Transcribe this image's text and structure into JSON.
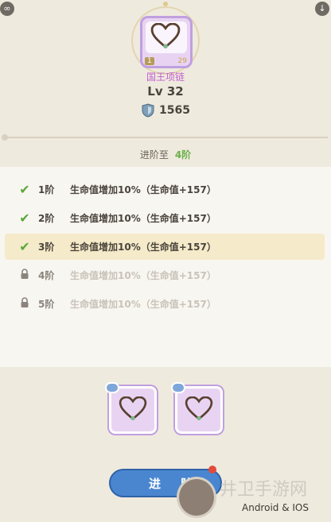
{
  "item": {
    "name": "国王项链",
    "level_tag": "1",
    "count_tag": "29",
    "level_text": "Lv 32",
    "power_value": "1565"
  },
  "advance": {
    "prefix": "进阶至",
    "target": "4阶"
  },
  "stages": [
    {
      "stage": "1阶",
      "desc": "生命值增加10%（生命值+157）",
      "status": "done"
    },
    {
      "stage": "2阶",
      "desc": "生命值增加10%（生命值+157）",
      "status": "done"
    },
    {
      "stage": "3阶",
      "desc": "生命值增加10%（生命值+157）",
      "status": "done"
    },
    {
      "stage": "4阶",
      "desc": "生命值增加10%（生命值+157）",
      "status": "locked"
    },
    {
      "stage": "5阶",
      "desc": "生命值增加10%（生命值+157）",
      "status": "locked"
    }
  ],
  "button": {
    "label": "进 阶"
  },
  "watermark": {
    "site": "井卫手游网",
    "platform": "Android & IOS"
  },
  "colors": {
    "background": "#efeade",
    "accent_green": "#6bb04a",
    "item_name": "#c060d0",
    "button_blue": "#4a86d0"
  }
}
